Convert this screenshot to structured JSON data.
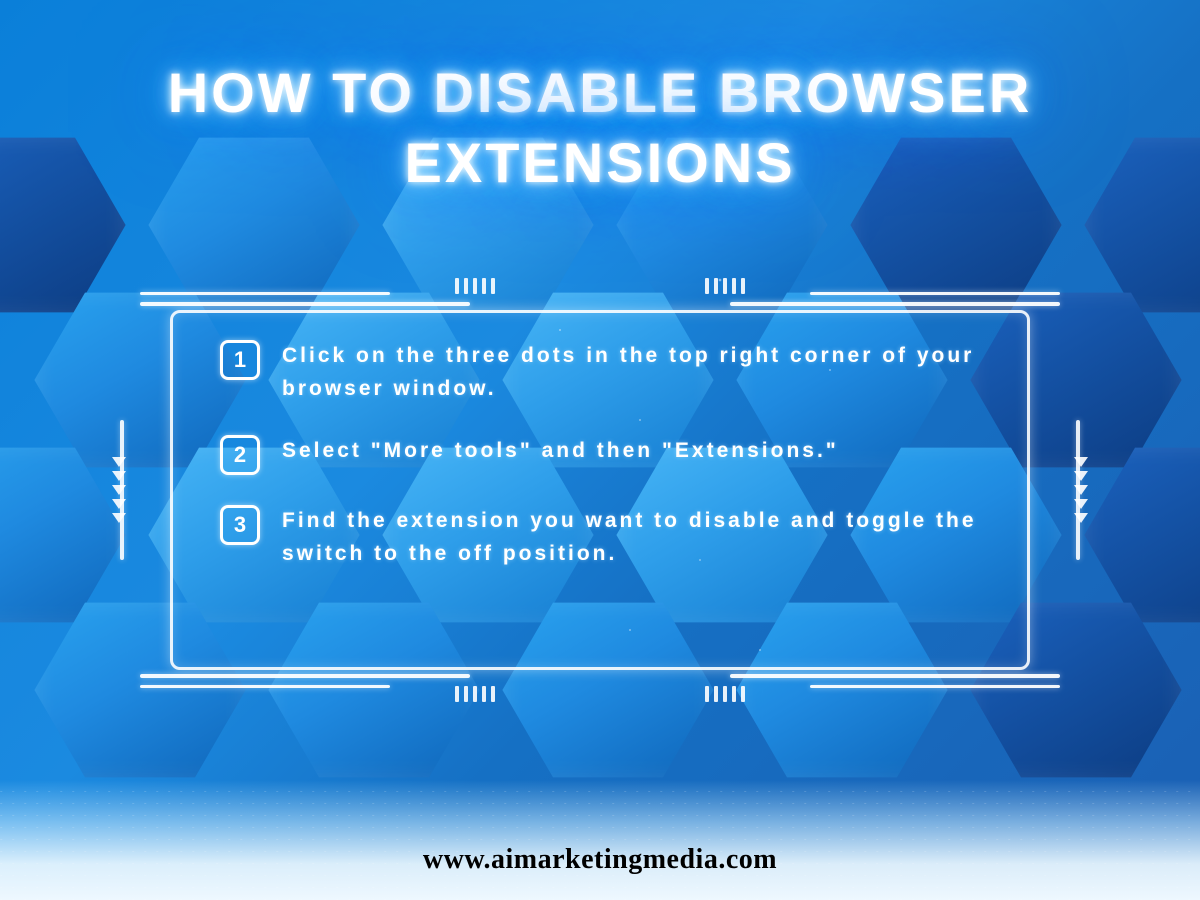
{
  "title_line1": "How to Disable Browser",
  "title_line2": "Extensions",
  "steps": [
    {
      "num": "1",
      "text": "Click on the three dots in the top right corner of your browser window."
    },
    {
      "num": "2",
      "text": "Select \"More tools\" and then \"Extensions.\""
    },
    {
      "num": "3",
      "text": "Find the extension you want to disable and toggle the switch to the off position."
    }
  ],
  "footer_url": "www.aimarketingmedia.com"
}
